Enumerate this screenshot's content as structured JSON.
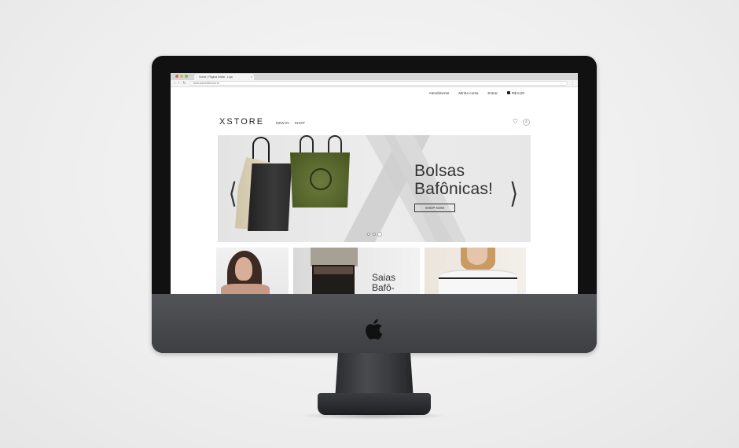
{
  "browser": {
    "tab_title": "Home | Página Inicial - Loja",
    "tab_close": "×",
    "url": "www.xstorebfd.com.br"
  },
  "util_bar": {
    "atendimento": "Atendimento",
    "minha_conta": "Minha conta",
    "entrar": "Entrar",
    "cart_total": "R$ 0,00"
  },
  "header": {
    "logo": "XSTORE",
    "nav": [
      "NEW IN",
      "SHOP"
    ]
  },
  "hero": {
    "title_line1": "Bolsas",
    "title_line2": "Bafônicas!",
    "button": "SHOP NOW",
    "prev_arrow": "❬",
    "next_arrow": "❭",
    "slides_count": 3,
    "active_slide": 3
  },
  "tiles": {
    "tile2_title_line1": "Saias",
    "tile2_title_line2": "Bafô-"
  },
  "icons": {
    "heart": "♡",
    "search": "⌕"
  }
}
